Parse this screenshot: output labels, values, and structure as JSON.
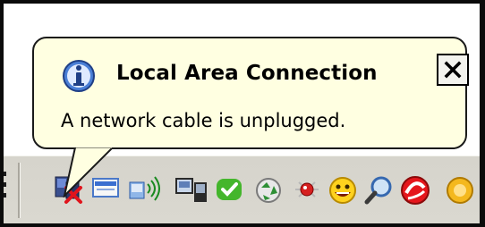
{
  "balloon": {
    "icon": "info-icon",
    "title": "Local Area Connection",
    "message": "A network cable is unplugged.",
    "close_icon": "close-icon"
  },
  "tray": {
    "icons": [
      "network-disconnected-icon",
      "mail-icon",
      "wireless-network-icon",
      "device-sync-icon",
      "messenger-icon",
      "recycle-icon",
      "bug-icon",
      "smiley-icon",
      "search-icon",
      "antivirus-icon",
      "partial-tray-icon"
    ]
  },
  "colors": {
    "balloon_bg": "#ffffe1",
    "taskbar_bg": "#d6d4cc",
    "error_red": "#e0141c"
  }
}
